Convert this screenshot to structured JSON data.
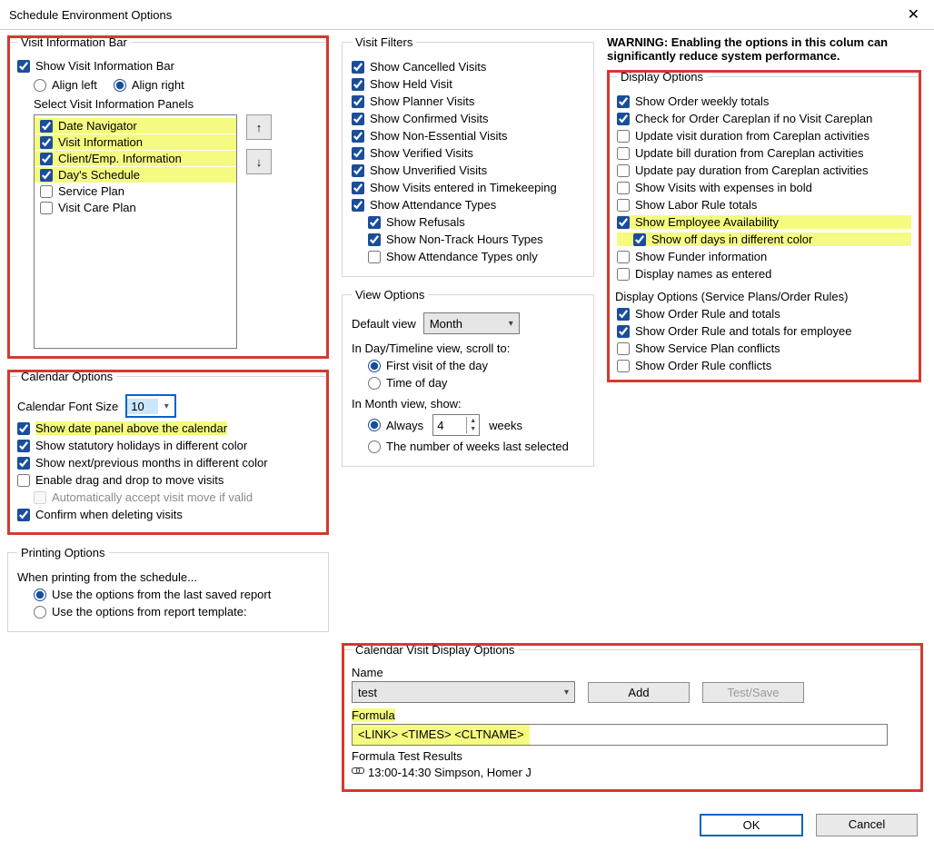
{
  "title": "Schedule Environment Options",
  "col1": {
    "visit_info_bar": {
      "legend": "Visit Information Bar",
      "show_bar": "Show Visit Information Bar",
      "align_left": "Align left",
      "align_right": "Align right",
      "select_panels_label": "Select Visit Information Panels",
      "panels": [
        {
          "label": "Date Navigator",
          "checked": true,
          "highlight": true
        },
        {
          "label": "Visit Information",
          "checked": true,
          "highlight": true
        },
        {
          "label": "Client/Emp. Information",
          "checked": true,
          "highlight": true
        },
        {
          "label": "Day's Schedule",
          "checked": true,
          "highlight": true
        },
        {
          "label": "Service Plan",
          "checked": false,
          "highlight": false
        },
        {
          "label": "Visit Care Plan",
          "checked": false,
          "highlight": false
        }
      ]
    },
    "calendar_options": {
      "legend": "Calendar Options",
      "font_size_label": "Calendar Font Size",
      "font_size_value": "10",
      "show_date_panel": "Show date panel above the calendar",
      "show_stat_holidays": "Show statutory holidays in different color",
      "show_next_prev_months": "Show next/previous months in different color",
      "enable_drag_drop": "Enable drag and drop to move visits",
      "auto_accept_move": "Automatically accept visit move if valid",
      "confirm_delete": "Confirm when deleting visits"
    },
    "printing": {
      "legend": "Printing Options",
      "when_printing": "When printing from the schedule...",
      "use_last_saved": "Use the options from the last saved report",
      "use_template": "Use the options from report template:"
    }
  },
  "col2": {
    "visit_filters": {
      "legend": "Visit Filters",
      "items": {
        "cancelled": "Show Cancelled Visits",
        "held": "Show Held Visit",
        "planner": "Show Planner Visits",
        "confirmed": "Show Confirmed Visits",
        "nonessential": "Show Non-Essential Visits",
        "verified": "Show Verified Visits",
        "unverified": "Show Unverified Visits",
        "timekeeping": "Show Visits entered in Timekeeping",
        "attendance": "Show Attendance Types",
        "refusals": "Show Refusals",
        "nontrack": "Show Non-Track Hours Types",
        "attendance_only": "Show Attendance Types only"
      }
    },
    "view_options": {
      "legend": "View Options",
      "default_view_label": "Default view",
      "default_view_value": "Month",
      "scroll_label": "In Day/Timeline view, scroll to:",
      "first_visit": "First visit of the day",
      "time_of_day": "Time of day",
      "month_show_label": "In Month view, show:",
      "always": "Always",
      "weeks_value": "4",
      "weeks_suffix": "weeks",
      "num_weeks_last": "The number of weeks last selected"
    }
  },
  "col3": {
    "warning": "WARNING: Enabling the options in this colum can significantly reduce system performance.",
    "display_options": {
      "legend": "Display Options",
      "items": {
        "weekly_totals": "Show Order weekly totals",
        "check_careplan": "Check for Order Careplan if no Visit Careplan",
        "update_visit_dur": "Update visit duration from Careplan activities",
        "update_bill_dur": "Update bill duration from Careplan activities",
        "update_pay_dur": "Update pay duration from Careplan activities",
        "expenses_bold": "Show Visits with expenses in bold",
        "labor_totals": "Show Labor Rule totals",
        "emp_avail": "Show Employee Availability",
        "off_days_color": "Show off days in different color",
        "funder_info": "Show Funder information",
        "names_entered": "Display names as entered"
      }
    },
    "display_options_sp": {
      "legend": "Display Options (Service Plans/Order Rules)",
      "items": {
        "rule_totals": "Show Order Rule and totals",
        "rule_totals_emp": "Show Order Rule and totals for employee",
        "sp_conflicts": "Show Service Plan conflicts",
        "rule_conflicts": "Show Order Rule conflicts"
      }
    }
  },
  "cvdo": {
    "legend": "Calendar Visit Display Options",
    "name_label": "Name",
    "name_value": "test",
    "add": "Add",
    "test_save": "Test/Save",
    "formula_label": "Formula",
    "formula_value": "<LINK> <TIMES> <CLTNAME>",
    "results_label": "Formula Test Results",
    "results_value": "13:00-14:30 Simpson, Homer J"
  },
  "buttons": {
    "ok": "OK",
    "cancel": "Cancel"
  }
}
